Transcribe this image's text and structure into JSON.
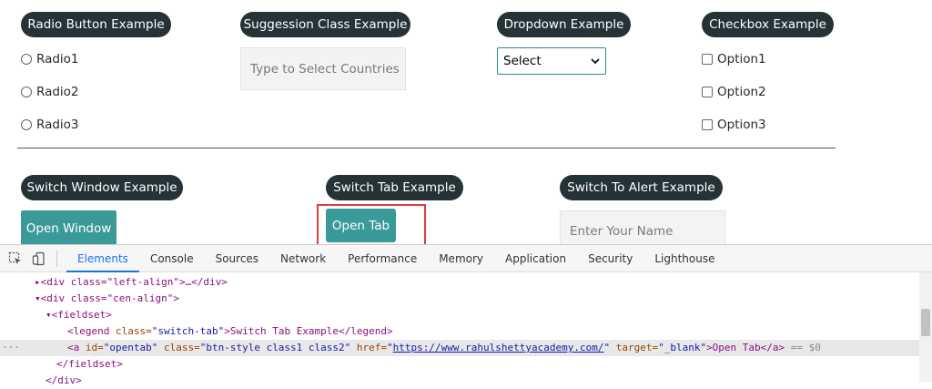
{
  "sections": {
    "radio": {
      "legend": "Radio Button Example",
      "options": [
        "Radio1",
        "Radio2",
        "Radio3"
      ]
    },
    "suggestion": {
      "legend": "Suggession Class Example",
      "placeholder": "Type to Select Countries"
    },
    "dropdown": {
      "legend": "Dropdown Example",
      "selected": "Select"
    },
    "checkbox": {
      "legend": "Checkbox Example",
      "options": [
        "Option1",
        "Option2",
        "Option3"
      ]
    },
    "switch_window": {
      "legend": "Switch Window Example",
      "button": "Open Window"
    },
    "switch_tab": {
      "legend": "Switch Tab Example",
      "button": "Open Tab"
    },
    "alert": {
      "legend": "Switch To Alert Example",
      "placeholder": "Enter Your Name"
    }
  },
  "devtools": {
    "tabs": [
      "Elements",
      "Console",
      "Sources",
      "Network",
      "Performance",
      "Memory",
      "Application",
      "Security",
      "Lighthouse"
    ],
    "active_tab": "Elements",
    "lines": {
      "l1": "▸<div class=\"left-align\">…</div>",
      "l2": "▾<div class=\"cen-align\">",
      "l3": "▾<fieldset>",
      "l4_tag_open": "<legend ",
      "l4_attr": "class=",
      "l4_val": "\"switch-tab\"",
      "l4_text": ">Switch Tab Example</legend>",
      "l5_open": "<a ",
      "l5_id_attr": "id=",
      "l5_id_val": "\"opentab\"",
      "l5_class_attr": " class=",
      "l5_class_val": "\"btn-style class1 class2\"",
      "l5_href_attr": " href=",
      "l5_href_q1": "\"",
      "l5_href_val": "https://www.rahulshettyacademy.com/",
      "l5_href_q2": "\"",
      "l5_target_attr": " target=",
      "l5_target_val": "\"_blank\"",
      "l5_text": ">Open Tab</a>",
      "l5_suffix": " == $0",
      "l6": "</fieldset>",
      "l7": "</div>",
      "ellipsis": "···"
    }
  },
  "colors": {
    "pill": "#253236",
    "teal": "#3a9a9a",
    "highlight": "#d9403e"
  }
}
